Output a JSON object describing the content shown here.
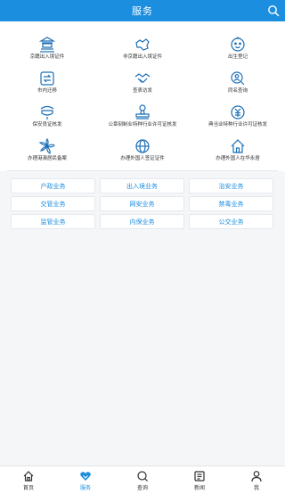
{
  "header": {
    "title": "服务"
  },
  "services": [
    {
      "label": "京籍出入境证件",
      "icon": "temple-icon"
    },
    {
      "label": "非京籍出入境证件",
      "icon": "map-icon"
    },
    {
      "label": "出生登记",
      "icon": "baby-icon"
    },
    {
      "label": "市内迁移",
      "icon": "transfer-icon"
    },
    {
      "label": "查表访发",
      "icon": "handshake-icon"
    },
    {
      "label": "同名查询",
      "icon": "search-person-icon"
    },
    {
      "label": "保安员证核发",
      "icon": "shield-icon"
    },
    {
      "label": "公章刻制业特种行业许可证核发",
      "icon": "stamp-icon"
    },
    {
      "label": "典当业特种行业许可证核发",
      "icon": "pawn-icon"
    },
    {
      "label": "办理港澳居民备案",
      "icon": "bauhinia-icon"
    },
    {
      "label": "办理外国人签证证件",
      "icon": "globe-icon"
    },
    {
      "label": "办理外国人在华永居",
      "icon": "home-icon"
    }
  ],
  "categories": [
    "户政业务",
    "出入境业务",
    "治安业务",
    "交管业务",
    "网安业务",
    "禁毒业务",
    "监管业务",
    "内保业务",
    "公交业务"
  ],
  "tabs": [
    {
      "label": "首页",
      "icon": "home-icon"
    },
    {
      "label": "服务",
      "icon": "heart-icon"
    },
    {
      "label": "查询",
      "icon": "search-icon"
    },
    {
      "label": "新闻",
      "icon": "news-icon"
    },
    {
      "label": "我",
      "icon": "user-icon"
    }
  ],
  "colors": {
    "accent": "#1c8ee0",
    "icon": "#1c6fb8"
  }
}
